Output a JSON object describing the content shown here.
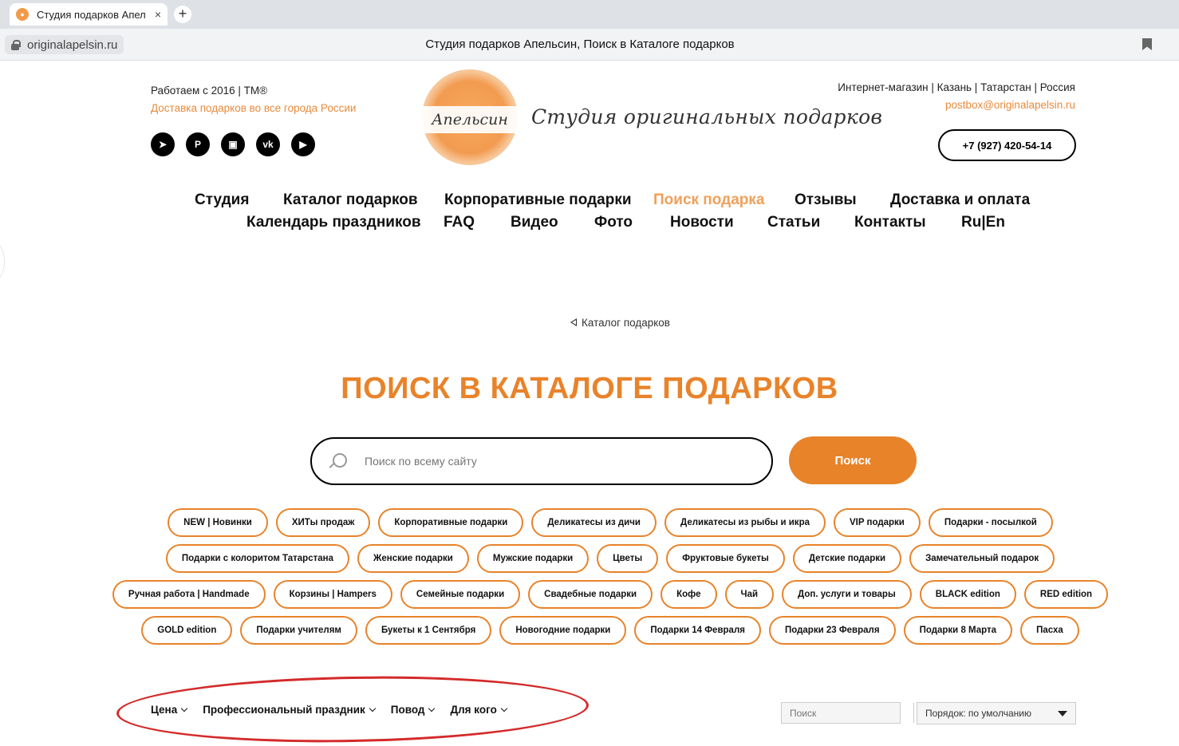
{
  "browser": {
    "tab_title": "Студия подарков Апел",
    "tab_close": "×",
    "new_tab": "+",
    "url": "originalapelsin.ru",
    "page_title": "Студия подарков Апельсин, Поиск в Каталоге подарков"
  },
  "header": {
    "working_since": "Работаем с 2016 | TM®",
    "delivery": "Доставка подарков во все города России",
    "socials": [
      {
        "icon": "telegram-icon",
        "glyph": "➤"
      },
      {
        "icon": "pinterest-icon",
        "glyph": "P"
      },
      {
        "icon": "gift-icon",
        "glyph": "▣"
      },
      {
        "icon": "vk-icon",
        "glyph": "vk"
      },
      {
        "icon": "youtube-icon",
        "glyph": "▶"
      }
    ],
    "logo_word": "Апельсин",
    "logo_tagline": "Студия оригинальных подарков",
    "region": "Интернет-магазин | Казань | Татарстан | Россия",
    "email": "postbox@originalapelsin.ru",
    "phone": "+7 (927) 420-54-14"
  },
  "nav": {
    "row1": [
      "Студия",
      "Каталог подарков",
      "Корпоративные подарки",
      "Поиск подарка",
      "Отзывы",
      "Доставка и оплата"
    ],
    "row2": [
      "Календарь праздников",
      "FAQ",
      "Видео",
      "Фото",
      "Новости",
      "Статьи",
      "Контакты",
      "Ru|En"
    ],
    "active": "Поиск подарка"
  },
  "breadcrumb": "Каталог подарков",
  "main_title": "ПОИСК В КАТАЛОГЕ ПОДАРКОВ",
  "search": {
    "placeholder": "Поиск по всему сайту",
    "button": "Поиск"
  },
  "tags": [
    [
      "NEW | Новинки",
      "ХИТы продаж",
      "Корпоративные подарки",
      "Деликатесы из дичи",
      "Деликатесы из рыбы и икра",
      "VIP подарки",
      "Подарки - посылкой"
    ],
    [
      "Подарки с колоритом Татарстана",
      "Женские подарки",
      "Мужские подарки",
      "Цветы",
      "Фруктовые букеты",
      "Детские подарки",
      "Замечательный подарок"
    ],
    [
      "Ручная работа | Handmade",
      "Корзины | Hampers",
      "Семейные подарки",
      "Свадебные подарки",
      "Кофе",
      "Чай",
      "Доп. услуги и товары",
      "BLACK edition",
      "RED edition"
    ],
    [
      "GOLD edition",
      "Подарки учителям",
      "Букеты к 1 Сентября",
      "Новогодние подарки",
      "Подарки 14 Февраля",
      "Подарки 23 Февраля",
      "Подарки 8 Марта",
      "Пасха"
    ]
  ],
  "filters": [
    "Цена",
    "Профессиональный праздник",
    "Повод",
    "Для кого"
  ],
  "mini_search_placeholder": "Поиск",
  "sort": "Порядок: по умолчанию",
  "colors": {
    "accent": "#e8832a",
    "highlight_ellipse": "#d42a2a"
  }
}
